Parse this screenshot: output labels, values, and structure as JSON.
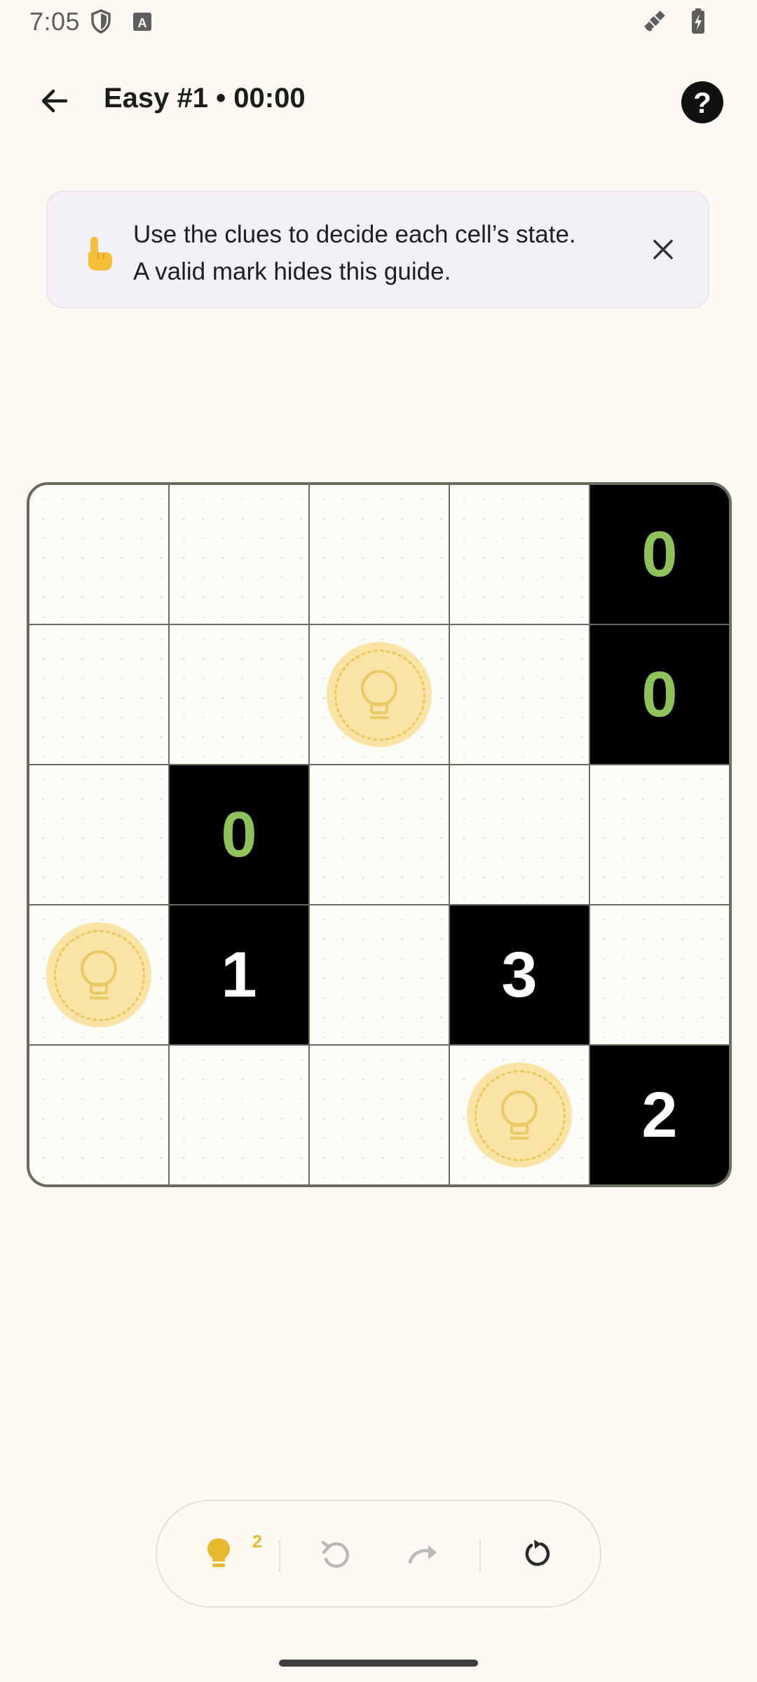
{
  "status_bar": {
    "time": "7:05",
    "icons_left": [
      "shield-icon",
      "keyboard-a-icon"
    ],
    "icons_right": [
      "satellite-icon",
      "battery-charging-icon"
    ]
  },
  "header": {
    "title": "Easy #1 • 00:00",
    "back_icon": "arrow-left-icon",
    "help_label": "?"
  },
  "guide": {
    "icon": "pointing-hand-icon",
    "line1": "Use the clues to decide each cell’s state.",
    "line2": "A valid mark hides this guide.",
    "close_icon": "close-icon"
  },
  "board": {
    "size": 5,
    "cells": [
      [
        {
          "type": "empty"
        },
        {
          "type": "empty"
        },
        {
          "type": "empty"
        },
        {
          "type": "empty"
        },
        {
          "type": "wall",
          "clue": "0",
          "satisfied": true
        }
      ],
      [
        {
          "type": "empty"
        },
        {
          "type": "empty"
        },
        {
          "type": "bulb"
        },
        {
          "type": "empty"
        },
        {
          "type": "wall",
          "clue": "0",
          "satisfied": true
        }
      ],
      [
        {
          "type": "empty"
        },
        {
          "type": "wall",
          "clue": "0",
          "satisfied": true
        },
        {
          "type": "empty"
        },
        {
          "type": "empty"
        },
        {
          "type": "empty"
        }
      ],
      [
        {
          "type": "bulb"
        },
        {
          "type": "wall",
          "clue": "1",
          "satisfied": false
        },
        {
          "type": "empty"
        },
        {
          "type": "wall",
          "clue": "3",
          "satisfied": false
        },
        {
          "type": "empty"
        }
      ],
      [
        {
          "type": "empty"
        },
        {
          "type": "empty"
        },
        {
          "type": "empty"
        },
        {
          "type": "bulb"
        },
        {
          "type": "wall",
          "clue": "2",
          "satisfied": false
        }
      ]
    ]
  },
  "toolbar": {
    "hint_count": "2",
    "icons": [
      "lightbulb-icon",
      "undo-icon",
      "redo-icon",
      "reset-icon"
    ]
  },
  "colors": {
    "background": "#fdfaf3",
    "wall": "#000000",
    "clue_satisfied": "#8fc25a",
    "clue_unsatisfied": "#ffffff",
    "bulb": "#f9e4a6",
    "bulb_dash": "#eac85a",
    "hint": "#e6b92e",
    "guide_bg": "#f4f0f8"
  }
}
